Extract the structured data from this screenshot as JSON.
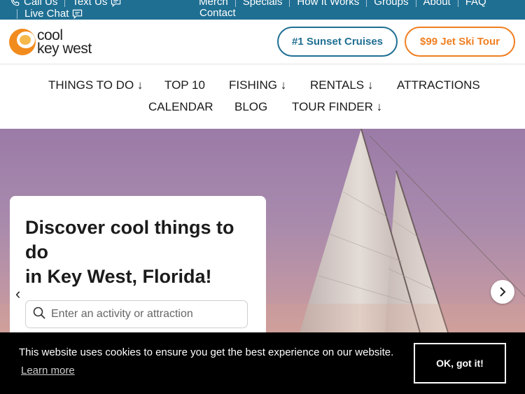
{
  "topbar": {
    "call_label": "Call Us",
    "text_label": "Text Us",
    "chat_label": "Live Chat",
    "links": [
      "Merch",
      "Specials",
      "How It Works",
      "Groups",
      "About",
      "FAQ"
    ],
    "contact_label": "Contact"
  },
  "header": {
    "logo_line1": "cool",
    "logo_line2": "key west",
    "cta_sunset": "#1 Sunset Cruises",
    "cta_jetski": "$99 Jet Ski Tour"
  },
  "nav": {
    "things_to_do": "THINGS TO DO",
    "top10": "TOP 10",
    "fishing": "FISHING",
    "rentals": "RENTALS",
    "attractions": "ATTRACTIONS",
    "calendar": "CALENDAR",
    "blog": "BLOG",
    "tour_finder": "TOUR FINDER",
    "dropdown_arrow": "↓"
  },
  "hero": {
    "headline": "Discover cool things to do\nin Key West, Florida!",
    "search_placeholder": "Enter an activity or attraction",
    "prev_glyph": "‹",
    "next_glyph": "›"
  },
  "cookie": {
    "message": "This website uses cookies to ensure you get the best experience on our website.",
    "learn_more": "Learn more",
    "ok_label": "OK, got it!"
  },
  "colors": {
    "brand_blue": "#1f6f93",
    "brand_orange": "#ef7f22"
  }
}
